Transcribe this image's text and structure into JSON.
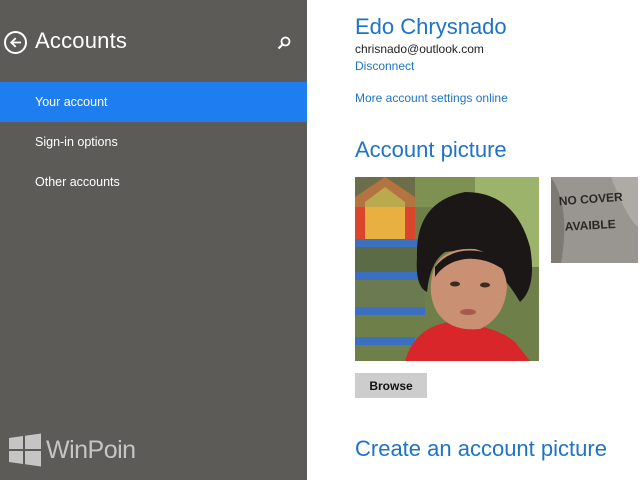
{
  "left_pane": {
    "title": "Accounts",
    "nav_items": [
      {
        "label": "Your account",
        "active": true
      },
      {
        "label": "Sign-in options",
        "active": false
      },
      {
        "label": "Other accounts",
        "active": false
      }
    ],
    "back_icon": "back-arrow-circle-icon",
    "search_icon": "search-icon",
    "background_color": "#5d5b58",
    "active_color": "#1e7ef0"
  },
  "watermark": {
    "text": "WinPoin",
    "icon": "windows-logo-icon"
  },
  "account": {
    "name": "Edo Chrysnado",
    "email": "chrisnado@outlook.com",
    "disconnect_label": "Disconnect",
    "more_settings_label": "More account settings online"
  },
  "account_picture": {
    "heading": "Account picture",
    "browse_label": "Browse",
    "previous_picture_text": "NO COVER AVAILABLE"
  },
  "create_picture": {
    "heading": "Create an account picture"
  },
  "accent_color": "#1e73c8"
}
